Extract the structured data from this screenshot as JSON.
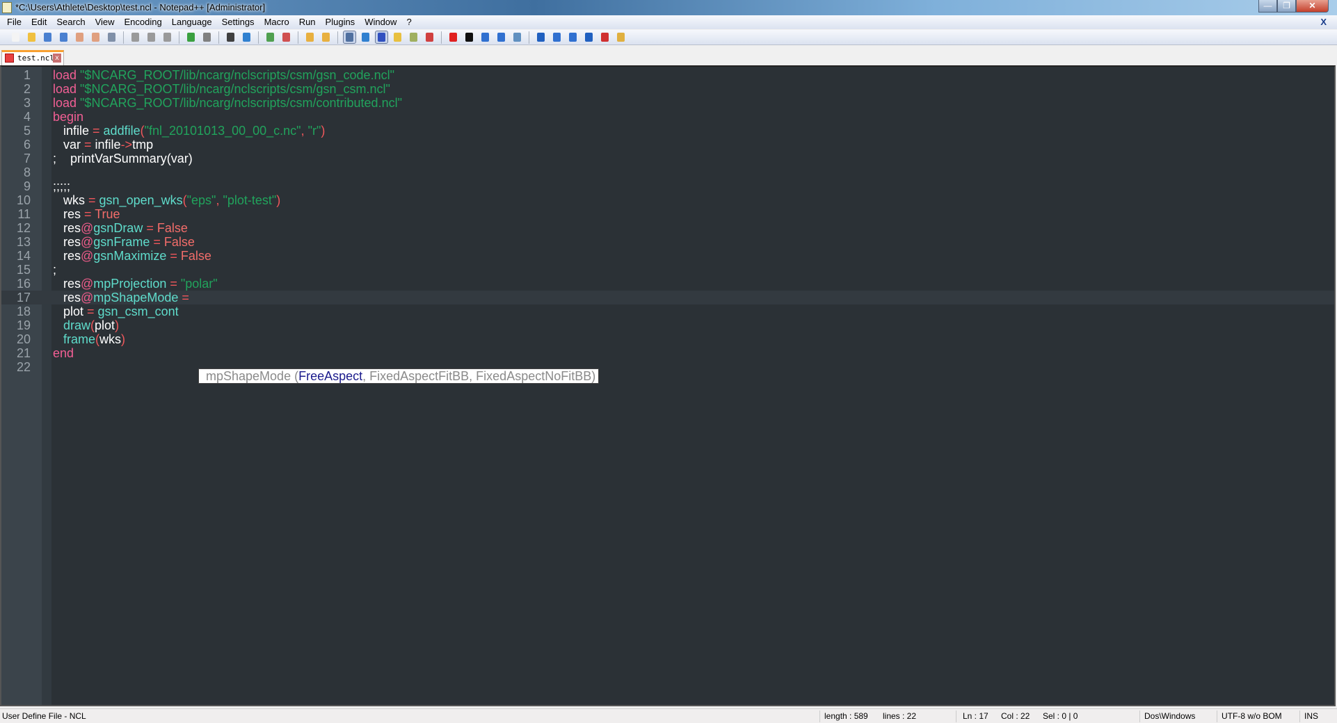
{
  "window": {
    "title": "*C:\\Users\\Athlete\\Desktop\\test.ncl - Notepad++ [Administrator]",
    "minimize": "—",
    "maximize": "❐",
    "close": "✕"
  },
  "menu": {
    "items": [
      "File",
      "Edit",
      "Search",
      "View",
      "Encoding",
      "Language",
      "Settings",
      "Macro",
      "Run",
      "Plugins",
      "Window",
      "?"
    ],
    "close_doc": "X"
  },
  "toolbar": {
    "icons": [
      {
        "name": "new-file",
        "color": "#f4f4f4"
      },
      {
        "name": "open-file",
        "color": "#f0c040"
      },
      {
        "name": "save",
        "color": "#4a80d0"
      },
      {
        "name": "save-all",
        "color": "#4a80d0"
      },
      {
        "name": "close",
        "color": "#e0a080"
      },
      {
        "name": "close-all",
        "color": "#e0a080"
      },
      {
        "name": "print",
        "color": "#8090a8"
      },
      "sep",
      {
        "name": "cut",
        "color": "#9a9a9a"
      },
      {
        "name": "copy",
        "color": "#9a9a9a"
      },
      {
        "name": "paste",
        "color": "#9a9a9a"
      },
      "sep",
      {
        "name": "undo",
        "color": "#3aa040"
      },
      {
        "name": "redo",
        "color": "#808080"
      },
      "sep",
      {
        "name": "find",
        "color": "#404040"
      },
      {
        "name": "replace",
        "color": "#3080d0"
      },
      "sep",
      {
        "name": "zoom-in",
        "color": "#50a050"
      },
      {
        "name": "zoom-out",
        "color": "#d05050"
      },
      "sep",
      {
        "name": "sync-vertical",
        "color": "#e8b040"
      },
      {
        "name": "sync-horizontal",
        "color": "#e8b040"
      },
      "sep",
      {
        "name": "word-wrap",
        "color": "#5070a0",
        "pressed": true
      },
      {
        "name": "show-all-chars",
        "color": "#3080d0"
      },
      {
        "name": "indent-guide",
        "color": "#3050c0",
        "pressed": true
      },
      {
        "name": "user-language",
        "color": "#e8c040"
      },
      {
        "name": "doc-map",
        "color": "#a0b060"
      },
      {
        "name": "function-list",
        "color": "#d04040"
      },
      "sep",
      {
        "name": "record-macro",
        "color": "#e02020"
      },
      {
        "name": "stop-record",
        "color": "#101010"
      },
      {
        "name": "play-macro",
        "color": "#3070d0"
      },
      {
        "name": "run-macro-multiple",
        "color": "#3070d0"
      },
      {
        "name": "save-macro",
        "color": "#6090c0"
      },
      "sep",
      {
        "name": "collapse-all",
        "color": "#2060c0"
      },
      {
        "name": "previous",
        "color": "#3070d0"
      },
      {
        "name": "next",
        "color": "#3070d0"
      },
      {
        "name": "expand-all",
        "color": "#2060c0"
      },
      {
        "name": "spell-check",
        "color": "#d03030"
      },
      {
        "name": "plugin-admin",
        "color": "#e0b040"
      }
    ]
  },
  "tab": {
    "label": "test.ncl",
    "close": "x"
  },
  "editor": {
    "current_line": 17,
    "lines": [
      [
        [
          "kw",
          "load "
        ],
        [
          "str",
          "\"$NCARG_ROOT/lib/ncarg/nclscripts/csm/gsn_code.ncl\""
        ]
      ],
      [
        [
          "kw",
          "load "
        ],
        [
          "str",
          "\"$NCARG_ROOT/lib/ncarg/nclscripts/csm/gsn_csm.ncl\""
        ]
      ],
      [
        [
          "kw",
          "load "
        ],
        [
          "str",
          "\"$NCARG_ROOT/lib/ncarg/nclscripts/csm/contributed.ncl\""
        ]
      ],
      [
        [
          "kw",
          "begin"
        ]
      ],
      [
        [
          "id",
          "   infile "
        ],
        [
          "op",
          "= "
        ],
        [
          "fn",
          "addfile"
        ],
        [
          "op",
          "("
        ],
        [
          "str",
          "\"fnl_20101013_00_00_c.nc\""
        ],
        [
          "op",
          ", "
        ],
        [
          "str",
          "\"r\""
        ],
        [
          "op",
          ")"
        ]
      ],
      [
        [
          "id",
          "   var "
        ],
        [
          "op",
          "= "
        ],
        [
          "id",
          "infile"
        ],
        [
          "op",
          "->"
        ],
        [
          "id",
          "tmp"
        ]
      ],
      [
        [
          "id",
          ";    printVarSummary(var)"
        ]
      ],
      [],
      [
        [
          "id",
          ";;;;;"
        ]
      ],
      [
        [
          "id",
          "   wks "
        ],
        [
          "op",
          "= "
        ],
        [
          "fn",
          "gsn_open_wks"
        ],
        [
          "op",
          "("
        ],
        [
          "str",
          "\"eps\""
        ],
        [
          "op",
          ", "
        ],
        [
          "str",
          "\"plot-test\""
        ],
        [
          "op",
          ")"
        ]
      ],
      [
        [
          "id",
          "   res "
        ],
        [
          "op",
          "= "
        ],
        [
          "bool",
          "True"
        ]
      ],
      [
        [
          "id",
          "   res"
        ],
        [
          "at",
          "@"
        ],
        [
          "fn",
          "gsnDraw"
        ],
        [
          "op",
          " = "
        ],
        [
          "bool",
          "False"
        ]
      ],
      [
        [
          "id",
          "   res"
        ],
        [
          "at",
          "@"
        ],
        [
          "fn",
          "gsnFrame"
        ],
        [
          "op",
          " = "
        ],
        [
          "bool",
          "False"
        ]
      ],
      [
        [
          "id",
          "   res"
        ],
        [
          "at",
          "@"
        ],
        [
          "fn",
          "gsnMaximize"
        ],
        [
          "op",
          " = "
        ],
        [
          "bool",
          "False"
        ]
      ],
      [
        [
          "id",
          ";"
        ]
      ],
      [
        [
          "id",
          "   res"
        ],
        [
          "at",
          "@"
        ],
        [
          "fn",
          "mpProjection"
        ],
        [
          "op",
          " = "
        ],
        [
          "str",
          "\"polar\""
        ]
      ],
      [
        [
          "id",
          "   res"
        ],
        [
          "at",
          "@"
        ],
        [
          "fn",
          "mpShapeMode"
        ],
        [
          "op",
          " ="
        ]
      ],
      [
        [
          "id",
          "   plot "
        ],
        [
          "op",
          "= "
        ],
        [
          "fn",
          "gsn_csm_cont"
        ]
      ],
      [
        [
          "fn",
          "   draw"
        ],
        [
          "op",
          "("
        ],
        [
          "id",
          "plot"
        ],
        [
          "op",
          ")"
        ]
      ],
      [
        [
          "fn",
          "   frame"
        ],
        [
          "op",
          "("
        ],
        [
          "id",
          "wks"
        ],
        [
          "op",
          ")"
        ]
      ],
      [
        [
          "kw",
          "end"
        ]
      ],
      []
    ]
  },
  "calltip": {
    "prefix": "mpShapeMode (",
    "highlighted": "FreeAspect",
    "rest": ", FixedAspectFitBB, FixedAspectNoFitBB)"
  },
  "status": {
    "language": "User Define File - NCL",
    "length": "length : 589",
    "lines": "lines : 22",
    "ln": "Ln : 17",
    "col": "Col : 22",
    "sel": "Sel : 0 | 0",
    "eol": "Dos\\Windows",
    "encoding": "UTF-8 w/o BOM",
    "mode": "INS"
  }
}
